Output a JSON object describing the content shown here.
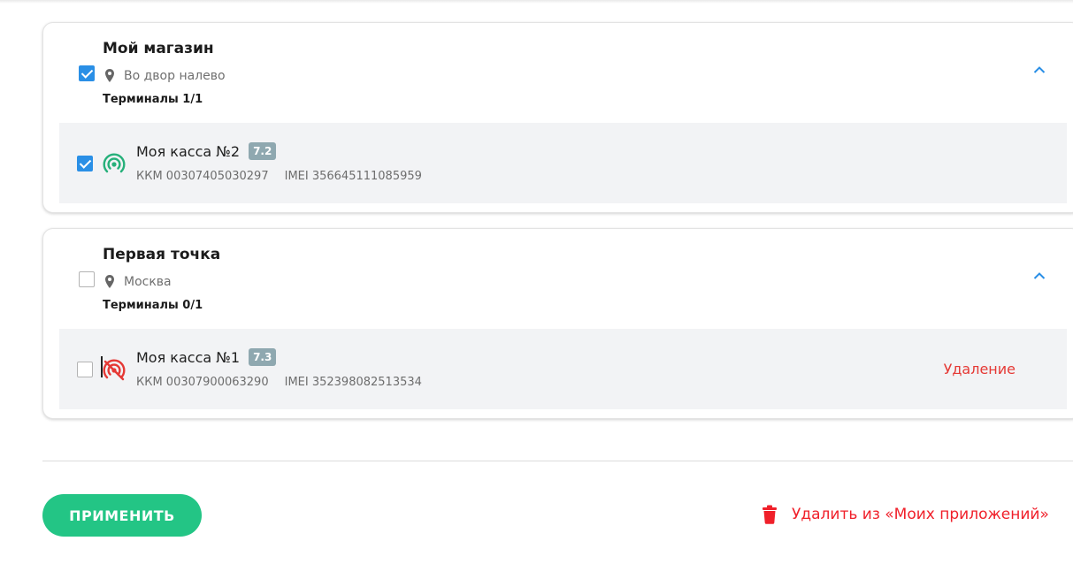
{
  "stores": [
    {
      "name": "Мой магазин",
      "address": "Во двор налево",
      "terminals_count": "Терминалы 1/1",
      "checked": true,
      "terminal": {
        "name": "Моя касса №2",
        "version": "7.2",
        "kkm": "ККМ 00307405030297",
        "imei": "IMEI 356645111085959",
        "status": "",
        "online": true
      }
    },
    {
      "name": "Первая точка",
      "address": "Москва",
      "terminals_count": "Терминалы 0/1",
      "checked": false,
      "terminal": {
        "name": "Моя касса №1",
        "version": "7.3",
        "kkm": "ККМ 00307900063290",
        "imei": "IMEI 352398082513534",
        "status": "Удаление",
        "online": false
      }
    }
  ],
  "actions": {
    "apply_label": "ПРИМЕНИТЬ",
    "delete_label": "Удалить из «Моих приложений»"
  },
  "colors": {
    "accent_green": "#23c585",
    "checkbox_blue": "#2a8fe6",
    "danger_red": "#f0202a",
    "badge_gray": "#8fa8b0"
  },
  "icons": {
    "location": "map-pin-icon",
    "expand": "chevron-up-icon",
    "online": "signal-online-icon",
    "offline": "signal-offline-icon",
    "delete": "trash-icon"
  }
}
